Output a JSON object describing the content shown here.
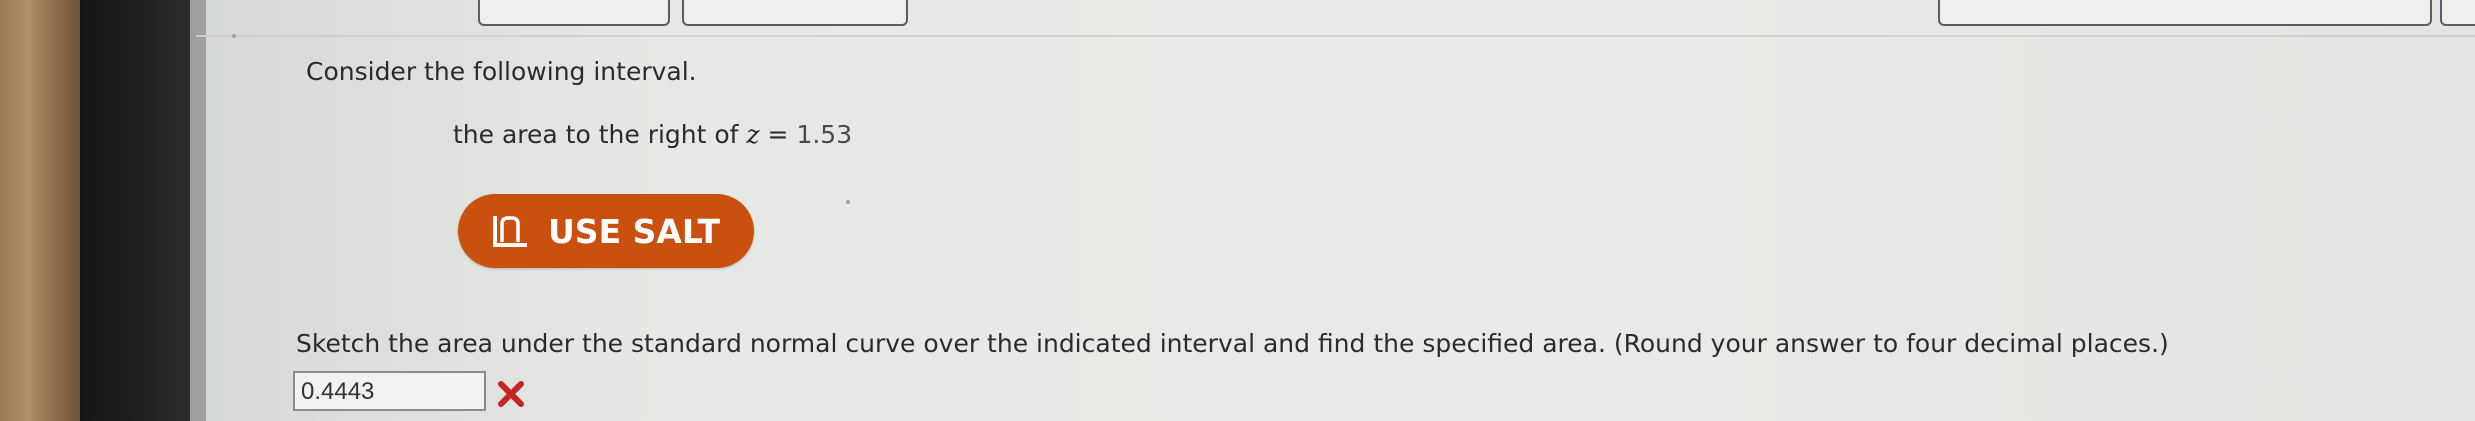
{
  "question": {
    "intro": "Consider the following interval.",
    "interval_text": "the area to the right of ",
    "z_var": "z",
    "equals": " = ",
    "z_value": "1.53",
    "tool_button_label": "USE SALT",
    "instructions": "Sketch the area under the standard normal curve over the indicated interval and find the specified area. (Round your answer to four decimal places.)",
    "answer_value": "0.4443",
    "answer_status": "incorrect"
  },
  "icons": {
    "salt": "salt-distribution-icon",
    "result": "x-mark-icon"
  },
  "colors": {
    "salt_button": "#c9500f",
    "incorrect_mark": "#c42525",
    "background": "#e6e8e5"
  }
}
